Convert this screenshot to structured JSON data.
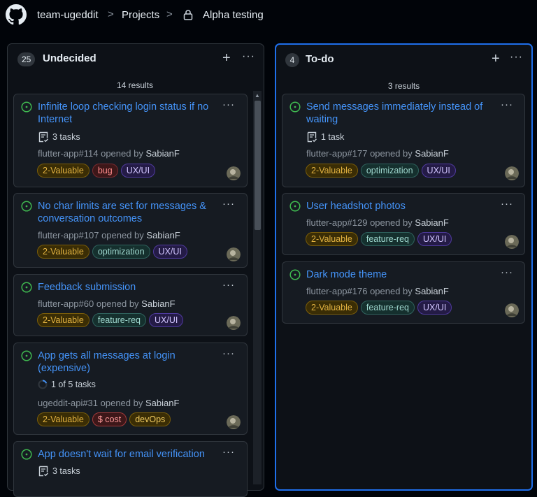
{
  "breadcrumb": {
    "org": "team-ugeddit",
    "section": "Projects",
    "project": "Alpha testing"
  },
  "label_colors": {
    "2-Valuable": {
      "bg": "#3a2d05",
      "border": "#7a5d0a",
      "text": "#e3b341"
    },
    "bug": {
      "bg": "#3d1719",
      "border": "#7a2b30",
      "text": "#ff8b8b"
    },
    "UX/UI": {
      "bg": "#241b46",
      "border": "#4f3a9e",
      "text": "#d2c6ff"
    },
    "optimization": {
      "bg": "#15302e",
      "border": "#2f625d",
      "text": "#9fd8cf"
    },
    "feature-req": {
      "bg": "#15302e",
      "border": "#2f625d",
      "text": "#9fd8cf"
    },
    "$ cost": {
      "bg": "#3d1719",
      "border": "#a33a3a",
      "text": "#ff9b9b"
    },
    "devOps": {
      "bg": "#3a2d05",
      "border": "#7a5d0a",
      "text": "#f2cc60"
    }
  },
  "columns": [
    {
      "count": "25",
      "name": "Undecided",
      "results": "14 results",
      "cards": [
        {
          "title": "Infinite loop checking login status if no Internet",
          "tasks": "3 tasks",
          "ref": "flutter-app#114 opened by ",
          "user": "SabianF",
          "labels": [
            "2-Valuable",
            "bug",
            "UX/UI"
          ]
        },
        {
          "title": "No char limits are set for messages & conversation outcomes",
          "ref": "flutter-app#107 opened by ",
          "user": "SabianF",
          "labels": [
            "2-Valuable",
            "optimization",
            "UX/UI"
          ]
        },
        {
          "title": "Feedback submission",
          "ref": "flutter-app#60 opened by ",
          "user": "SabianF",
          "labels": [
            "2-Valuable",
            "feature-req",
            "UX/UI"
          ]
        },
        {
          "title": "App gets all messages at login (expensive)",
          "progress": "1 of 5 tasks",
          "ref": "ugeddit-api#31 opened by ",
          "user": "SabianF",
          "labels": [
            "2-Valuable",
            "$ cost",
            "devOps"
          ]
        },
        {
          "title": "App doesn't wait for email verification",
          "tasks": "3 tasks"
        }
      ]
    },
    {
      "count": "4",
      "name": "To-do",
      "results": "3 results",
      "cards": [
        {
          "title": "Send messages immediately instead of waiting",
          "tasks": "1 task",
          "ref": "flutter-app#177 opened by ",
          "user": "SabianF",
          "labels": [
            "2-Valuable",
            "optimization",
            "UX/UI"
          ]
        },
        {
          "title": "User headshot photos",
          "ref": "flutter-app#129 opened by ",
          "user": "SabianF",
          "labels": [
            "2-Valuable",
            "feature-req",
            "UX/UI"
          ]
        },
        {
          "title": "Dark mode theme",
          "ref": "flutter-app#176 opened by ",
          "user": "SabianF",
          "labels": [
            "2-Valuable",
            "feature-req",
            "UX/UI"
          ]
        }
      ]
    }
  ],
  "icons": {
    "logo": "github-logo-icon",
    "lock": "lock-icon",
    "status": "open-issue-icon",
    "tasks": "task-list-icon",
    "progress": "progress-ring-icon",
    "add": "plus-icon",
    "more": "kebab-menu-icon"
  },
  "glyphs": {
    "sep": ">",
    "plus": "+",
    "more": "···"
  }
}
